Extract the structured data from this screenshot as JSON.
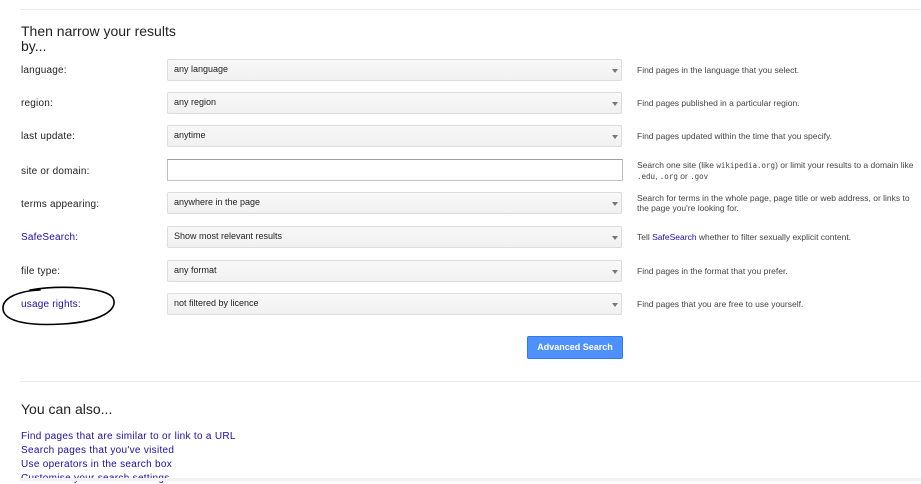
{
  "section_heading": "Then narrow your results by...",
  "rows": [
    {
      "label": "language:",
      "value": "any language",
      "help": "Find pages in the language that you select."
    },
    {
      "label": "region:",
      "value": "any region",
      "help": "Find pages published in a particular region."
    },
    {
      "label": "last update:",
      "value": "anytime",
      "help": "Find pages updated within the time that you specify."
    },
    {
      "label": "site or domain:",
      "value": "",
      "help_a": "Search one site (like ",
      "help_mono1": "wikipedia.org",
      "help_b": ") or limit your results to a domain like",
      "help_mono2": ".edu",
      "help_c": ", ",
      "help_mono3": ".org",
      "help_d": " or ",
      "help_mono4": ".gov"
    },
    {
      "label": "terms appearing:",
      "value": "anywhere in the page",
      "help": "Search for terms in the whole page, page title or web address, or links to the page you're looking for."
    },
    {
      "label": "SafeSearch:",
      "value": "Show most relevant results",
      "help_a": "Tell ",
      "help_link": "SafeSearch",
      "help_b": " whether to filter sexually explicit content."
    },
    {
      "label": "file type:",
      "value": "any format",
      "help": "Find pages in the format that you prefer."
    },
    {
      "label": "usage rights:",
      "value": "not filtered by licence",
      "help": "Find pages that you are free to use yourself."
    }
  ],
  "advanced_search_button": "Advanced Search",
  "also_heading": "You can also...",
  "also_links": [
    "Find pages that are similar to or link to a URL",
    "Search pages that you've visited",
    "Use operators in the search box",
    "Customise your search settings"
  ],
  "colors": {
    "link": "#1a0dab",
    "button": "#4d90fe",
    "annotation": "#000000"
  }
}
